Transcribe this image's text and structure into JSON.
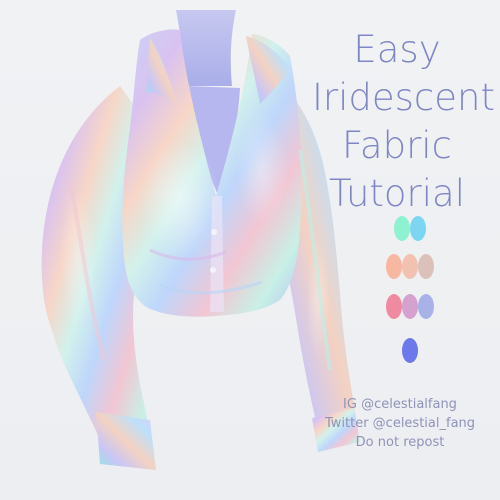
{
  "title": {
    "lines": [
      "Easy",
      "Iridescent",
      "Fabric",
      "Tutorial"
    ]
  },
  "palette": {
    "rows": [
      [
        "#8ef1cf",
        "#7cd6f2"
      ],
      [
        "#f7b7a0",
        "#f3c1b0",
        "#dcc1ba"
      ],
      [
        "#f08aa1",
        "#d5a1cf",
        "#a9b1e9"
      ],
      [
        "#6d78ea"
      ]
    ]
  },
  "credits": {
    "lines": [
      "IG @celestialfang",
      "Twitter @celestial_fang",
      "Do not repost"
    ]
  },
  "colors": {
    "title": "#7f86c6",
    "credits": "#8f93b8",
    "background": "#eef0f2"
  },
  "illustration": {
    "subject": "iridescent-shirt-on-mannequin"
  }
}
